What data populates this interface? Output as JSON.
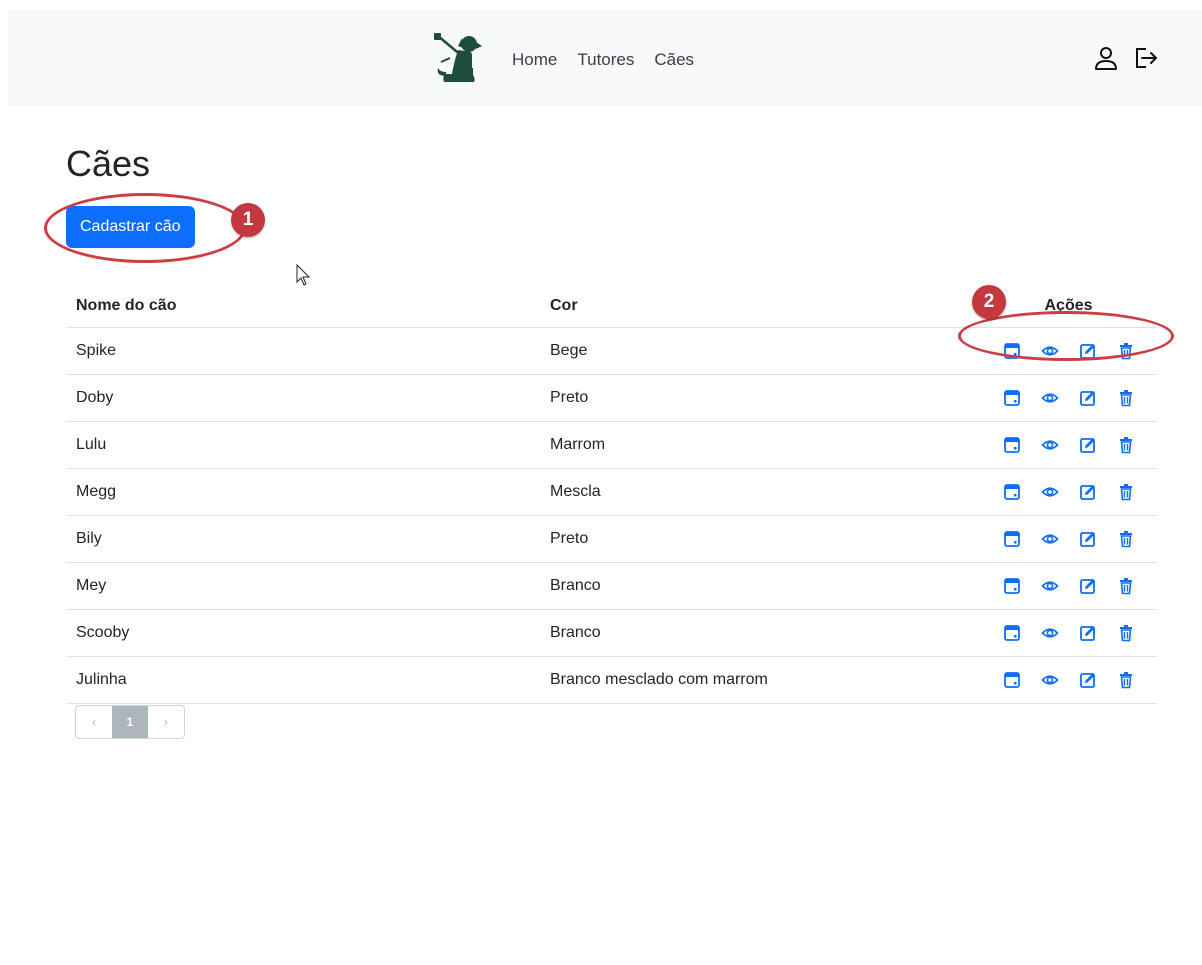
{
  "nav": {
    "links": [
      "Home",
      "Tutores",
      "Cães"
    ],
    "brand_icon": "dog-logo-icon",
    "right_icons": [
      "user-icon",
      "logout-icon"
    ]
  },
  "page": {
    "title": "Cães",
    "add_button_label": "Cadastrar cão"
  },
  "annotations": [
    "1",
    "2"
  ],
  "table": {
    "headers": [
      "Nome do cão",
      "Cor",
      "Ações"
    ],
    "action_icons": [
      "calendar-icon",
      "eye-icon",
      "edit-icon",
      "trash-icon"
    ],
    "rows": [
      {
        "name": "Spike",
        "color": "Bege"
      },
      {
        "name": "Doby",
        "color": "Preto"
      },
      {
        "name": "Lulu",
        "color": "Marrom"
      },
      {
        "name": "Megg",
        "color": "Mescla"
      },
      {
        "name": "Bily",
        "color": "Preto"
      },
      {
        "name": "Mey",
        "color": "Branco"
      },
      {
        "name": "Scooby",
        "color": "Branco"
      },
      {
        "name": "Julinha",
        "color": "Branco mesclado com marrom"
      }
    ]
  },
  "pagination": {
    "prev": "‹",
    "current": "1",
    "next": "›"
  },
  "colors": {
    "primary": "#0d6efd",
    "annotation": "#c5383f",
    "logo": "#1e4d3a"
  }
}
